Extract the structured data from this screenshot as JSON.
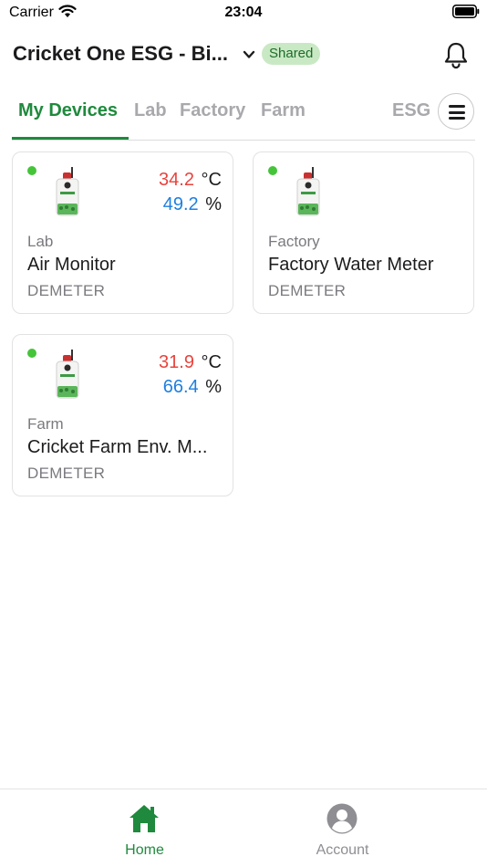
{
  "status_bar": {
    "carrier": "Carrier",
    "time": "23:04"
  },
  "header": {
    "title": "Cricket One ESG - Bi...",
    "shared_badge": "Shared"
  },
  "tabs": {
    "items": [
      {
        "label": "My Devices",
        "active": true
      },
      {
        "label": "Lab",
        "active": false
      },
      {
        "label": "Factory",
        "active": false
      },
      {
        "label": "Farm",
        "active": false
      },
      {
        "label": "ESG",
        "active": false
      }
    ]
  },
  "devices": [
    {
      "location": "Lab",
      "name": "Air Monitor",
      "brand": "DEMETER",
      "online": true,
      "temperature": "34.2",
      "temperature_unit": "°C",
      "humidity": "49.2",
      "humidity_unit": "%"
    },
    {
      "location": "Factory",
      "name": "Factory Water Meter",
      "brand": "DEMETER",
      "online": true
    },
    {
      "location": "Farm",
      "name": "Cricket Farm Env. M...",
      "brand": "DEMETER",
      "online": true,
      "temperature": "31.9",
      "temperature_unit": "°C",
      "humidity": "66.4",
      "humidity_unit": "%"
    }
  ],
  "bottom_nav": {
    "home_label": "Home",
    "account_label": "Account"
  },
  "colors": {
    "accent": "#1f8a3d",
    "temperature": "#e8433d",
    "humidity": "#1e7fe0",
    "online": "#45c43a",
    "shared_badge_bg": "#c9e9c4"
  },
  "icons": {
    "status": [
      "wifi-icon",
      "battery-icon"
    ],
    "header": [
      "chevron-down-icon",
      "bell-icon"
    ],
    "tabs": [
      "menu-icon"
    ],
    "bottom_nav": [
      "home-icon",
      "account-icon"
    ]
  }
}
